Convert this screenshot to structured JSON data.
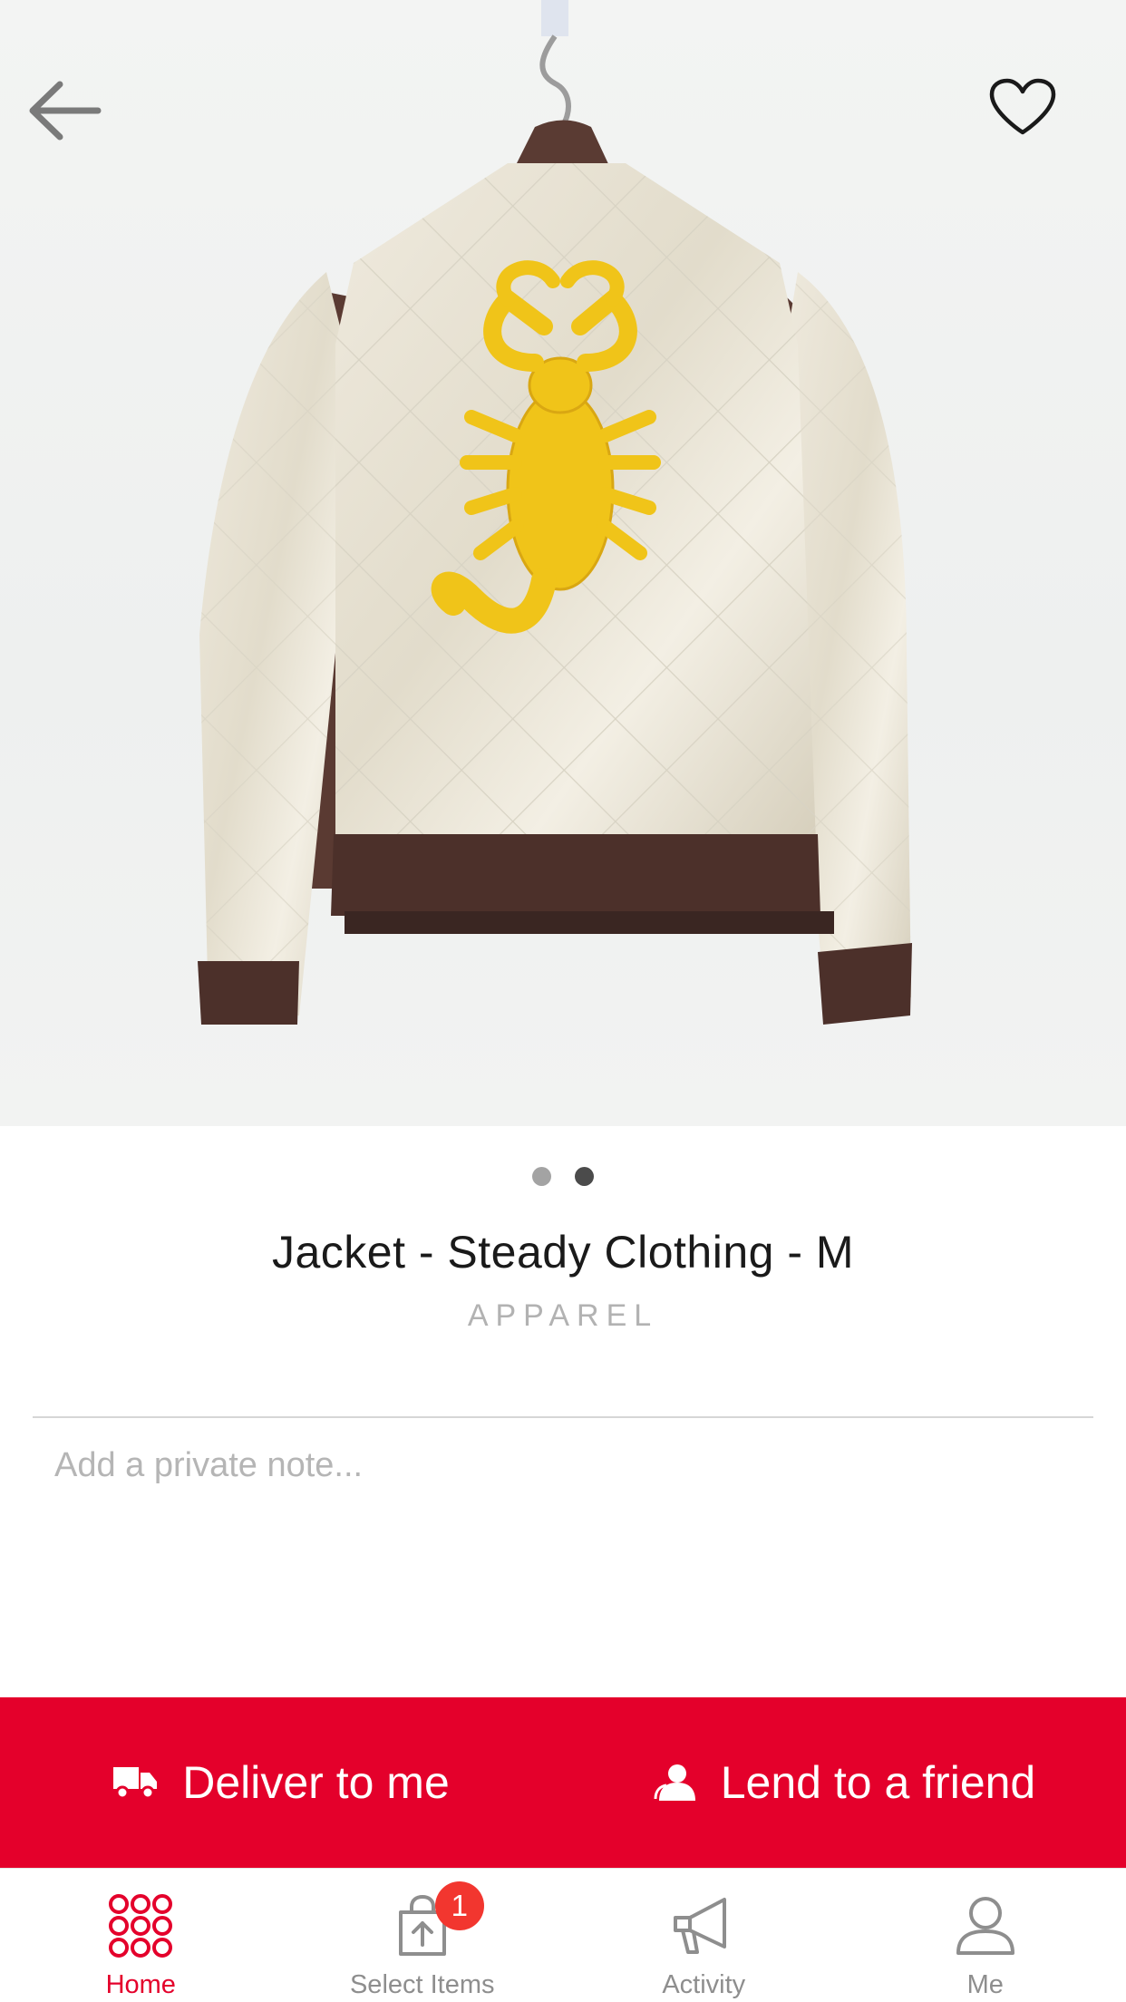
{
  "header": {
    "back_icon": "arrow-left-icon",
    "favorite_icon": "heart-outline-icon"
  },
  "gallery": {
    "page_count": 2,
    "active_index": 1
  },
  "product": {
    "title": "Jacket - Steady Clothing - M",
    "category": "APPAREL"
  },
  "note": {
    "placeholder": "Add a private note...",
    "value": ""
  },
  "actions": {
    "deliver_label": "Deliver to me",
    "deliver_icon": "truck-icon",
    "lend_label": "Lend to a friend",
    "lend_icon": "person-icon"
  },
  "tabs": [
    {
      "label": "Home",
      "icon": "grid-dots-icon",
      "active": true
    },
    {
      "label": "Select Items",
      "icon": "bag-upload-icon",
      "badge": "1"
    },
    {
      "label": "Activity",
      "icon": "megaphone-icon"
    },
    {
      "label": "Me",
      "icon": "person-outline-icon"
    }
  ],
  "colors": {
    "accent": "#e4002b",
    "badge": "#f2362f",
    "inactive_tab": "#8e8e8e"
  }
}
